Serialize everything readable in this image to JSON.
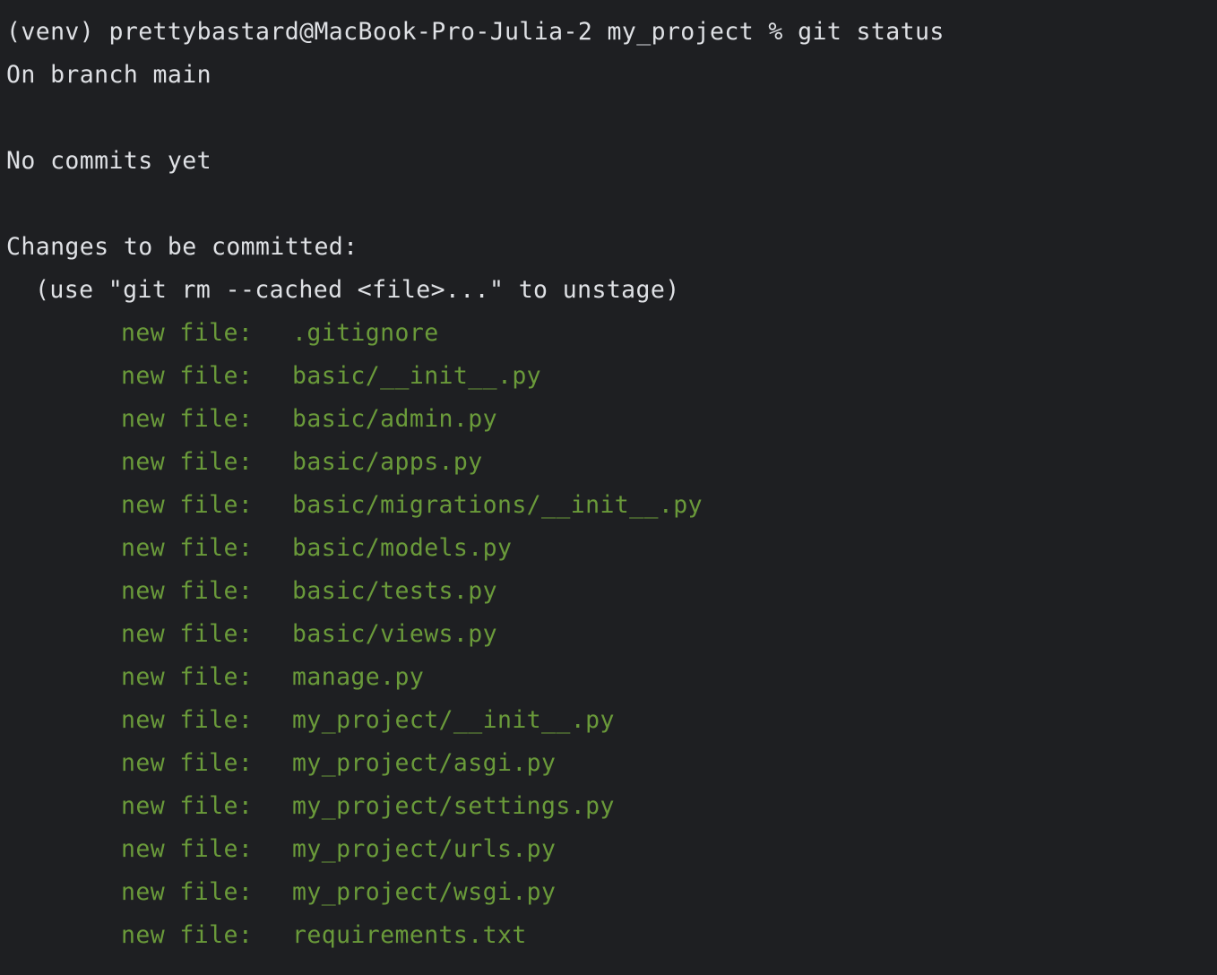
{
  "terminal": {
    "prompt_line": "(venv) prettybastard@MacBook-Pro-Julia-2 my_project % git status",
    "branch_line": "On branch main",
    "commits_line": "No commits yet",
    "changes_header": "Changes to be committed:",
    "hint_line": "(use \"git rm --cached <file>...\" to unstage)",
    "status_label": "new file:",
    "files": [
      ".gitignore",
      "basic/__init__.py",
      "basic/admin.py",
      "basic/apps.py",
      "basic/migrations/__init__.py",
      "basic/models.py",
      "basic/tests.py",
      "basic/views.py",
      "manage.py",
      "my_project/__init__.py",
      "my_project/asgi.py",
      "my_project/settings.py",
      "my_project/urls.py",
      "my_project/wsgi.py",
      "requirements.txt"
    ],
    "colors": {
      "background": "#1e1f22",
      "text": "#dfe1e5",
      "staged": "#6a9a3a"
    }
  }
}
